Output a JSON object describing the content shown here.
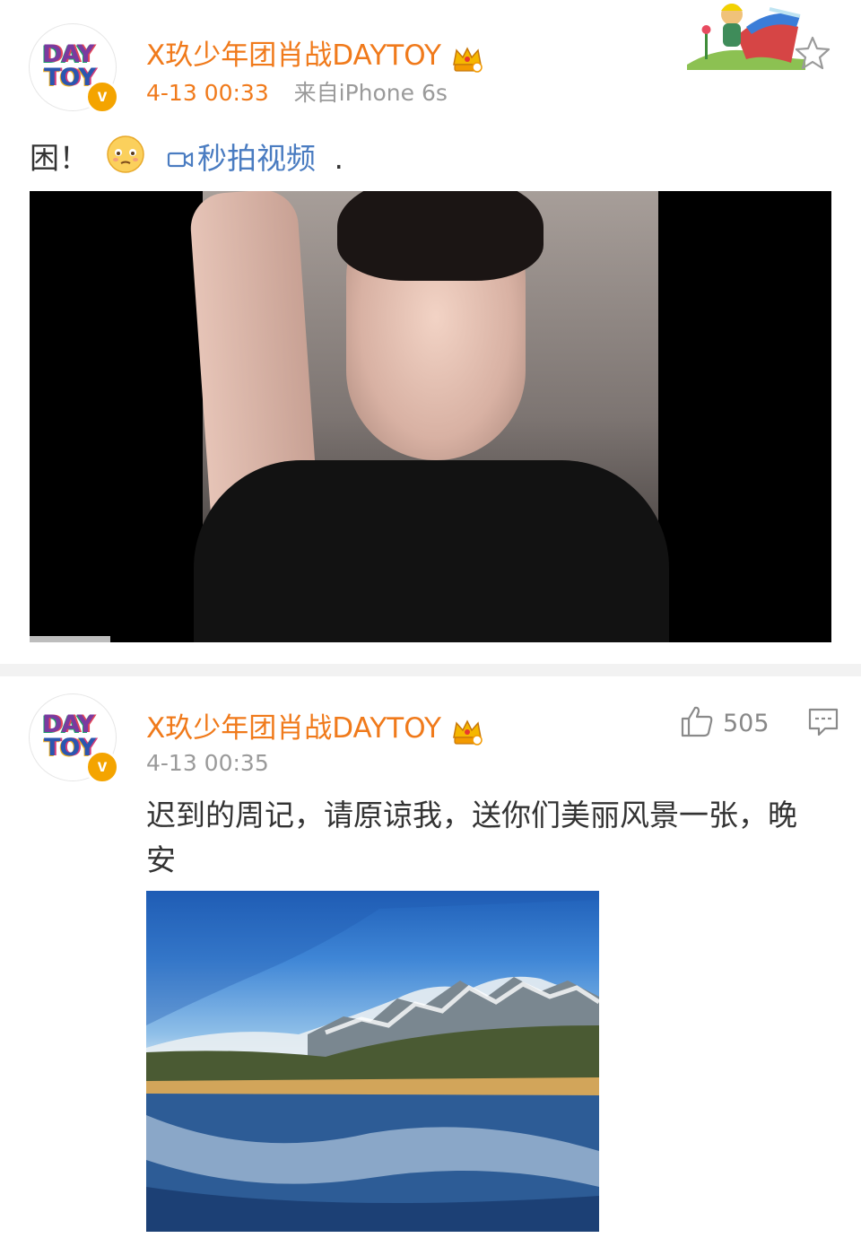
{
  "post1": {
    "username": "X玖少年团肖战DAYTOY",
    "avatar_text_line1": "DAY",
    "avatar_text_line2": "TOY",
    "verified_mark": "v",
    "time": "4-13 00:33",
    "source": "来自iPhone 6s",
    "text_prefix": "困！",
    "video_link": "秒拍视频",
    "text_suffix": "."
  },
  "post2": {
    "username": "X玖少年团肖战DAYTOY",
    "avatar_text_line1": "DAY",
    "avatar_text_line2": "TOY",
    "verified_mark": "v",
    "time": "4-13 00:35",
    "text_line1": "迟到的周记，请原谅我，送你们美丽风景一张，晚",
    "text_line2": "安",
    "like_count": "505"
  },
  "icons": {
    "crown": "crown-badge-icon",
    "star": "star-icon",
    "like": "thumbs-up-icon",
    "comment": "comment-icon",
    "video": "video-camera-icon",
    "emoji": "sad-face-emoji-icon"
  },
  "colors": {
    "username": "#f07a1b",
    "link": "#4a7cc1",
    "verified": "#f4a400",
    "text": "#333333",
    "meta": "#9a9a9a"
  }
}
